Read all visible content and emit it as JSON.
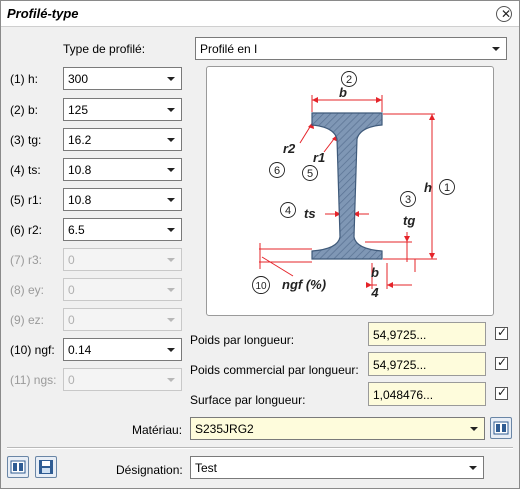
{
  "window": {
    "title": "Profilé-type"
  },
  "type_profile": {
    "label": "Type de profilé:",
    "value": "Profilé en I"
  },
  "params": [
    {
      "label": "(1) h:",
      "value": "300",
      "enabled": true
    },
    {
      "label": "(2) b:",
      "value": "125",
      "enabled": true
    },
    {
      "label": "(3) tg:",
      "value": "16.2",
      "enabled": true
    },
    {
      "label": "(4) ts:",
      "value": "10.8",
      "enabled": true
    },
    {
      "label": "(5) r1:",
      "value": "10.8",
      "enabled": true
    },
    {
      "label": "(6) r2:",
      "value": "6.5",
      "enabled": true
    },
    {
      "label": "(7) r3:",
      "value": "0",
      "enabled": false
    },
    {
      "label": "(8) ey:",
      "value": "0",
      "enabled": false
    },
    {
      "label": "(9) ez:",
      "value": "0",
      "enabled": false
    },
    {
      "label": "(10) ngf:",
      "value": "0.14",
      "enabled": true
    },
    {
      "label": "(11) ngs:",
      "value": "0",
      "enabled": false
    }
  ],
  "diagram": {
    "labels": {
      "b": "b",
      "r2": "r2",
      "r1": "r1",
      "ts": "ts",
      "tg": "tg",
      "h": "h",
      "ngf": "ngf (%)",
      "bottom_b": "b",
      "bottom_4": "4"
    },
    "markers": {
      "n1": "1",
      "n2": "2",
      "n3": "3",
      "n4": "4",
      "n5": "5",
      "n6": "6",
      "n10": "10"
    },
    "colors": {
      "section_fill": "#7f97b5",
      "section_stroke": "#3f5a7a",
      "dim_line": "#e5242a"
    }
  },
  "properties": [
    {
      "label": "Poids par longueur:",
      "value": "54,9725...",
      "checked": true
    },
    {
      "label": "Poids commercial par longueur:",
      "value": "54,9725...",
      "checked": true
    },
    {
      "label": "Surface par longueur:",
      "value": "1,048476...",
      "checked": true
    }
  ],
  "material": {
    "label": "Matériau:",
    "value": "S235JRG2"
  },
  "designation": {
    "label": "Désignation:",
    "value": "Test"
  }
}
